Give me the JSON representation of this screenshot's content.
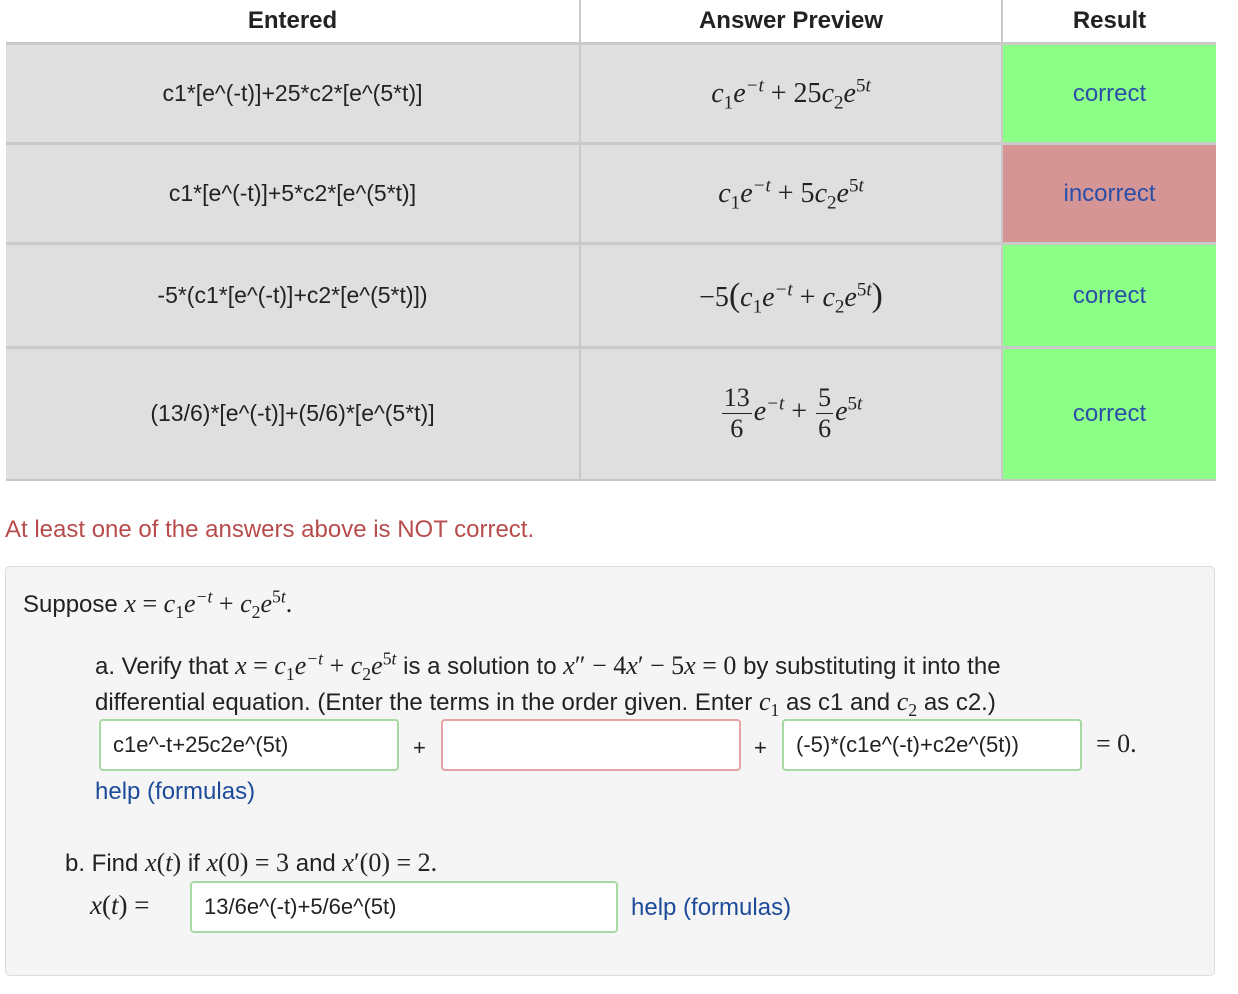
{
  "table": {
    "headers": [
      "Entered",
      "Answer Preview",
      "Result"
    ],
    "rows": [
      {
        "entered": "c1*[e^(-t)]+25*c2*[e^(5*t)]",
        "result": "correct"
      },
      {
        "entered": "c1*[e^(-t)]+5*c2*[e^(5*t)]",
        "result": "incorrect"
      },
      {
        "entered": "-5*(c1*[e^(-t)]+c2*[e^(5*t)])",
        "result": "correct"
      },
      {
        "entered": "(13/6)*[e^(-t)]+(5/6)*[e^(5*t)]",
        "result": "correct"
      }
    ],
    "colors": {
      "correct": "#8cff86",
      "incorrect": "#d59595"
    }
  },
  "warning": "At least one of the answers above is NOT correct.",
  "problem": {
    "intro": "Suppose",
    "part_a": {
      "text1": "a. Verify that",
      "text2": "is a solution to",
      "text3": "by substituting it into the",
      "text4": "differential equation. (Enter the terms in the order given. Enter",
      "text5": "as c1 and",
      "text6": "as c2.)",
      "input1_value": "c1e^-t+25c2e^(5t)",
      "input2_value": "",
      "input3_value": "(-5)*(c1e^(-t)+c2e^(5t))",
      "plus": "+",
      "help": "help (formulas)"
    },
    "part_b": {
      "text1": "b. Find",
      "text2": "if",
      "text3": "and",
      "input_value": "13/6e^(-t)+5/6e^(5t)",
      "help": "help (formulas)"
    }
  }
}
